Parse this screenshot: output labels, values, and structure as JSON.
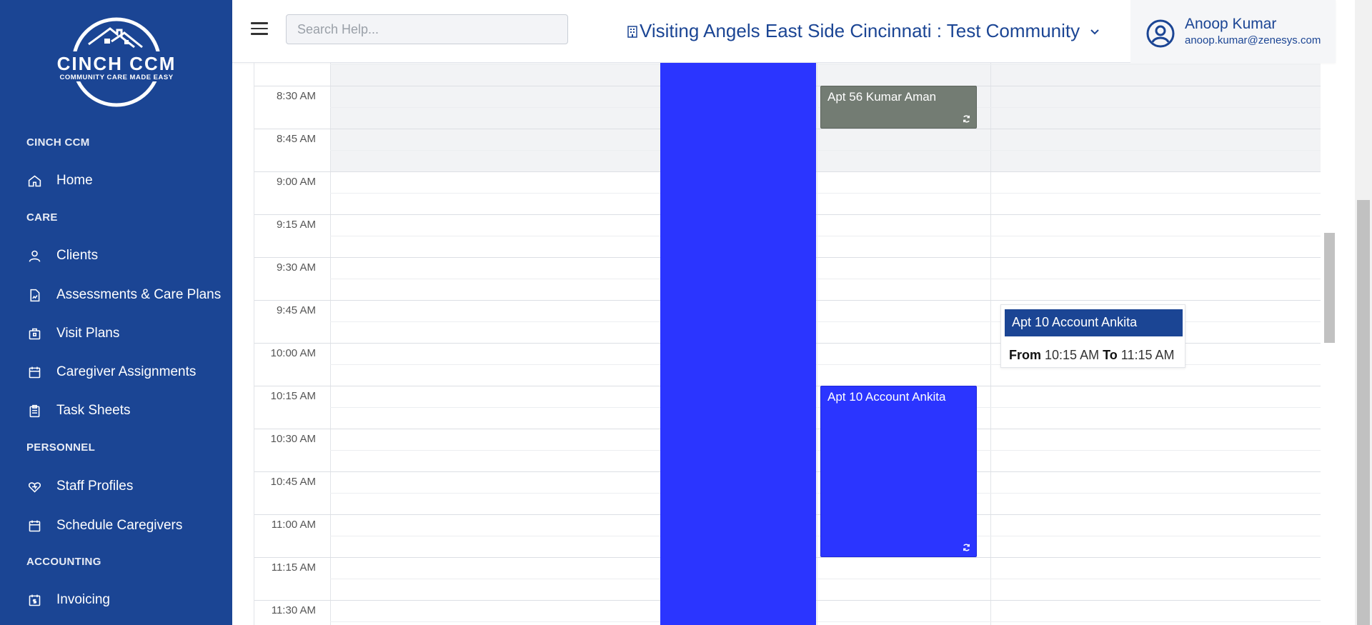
{
  "brand": {
    "logo_title": "CINCH CCM",
    "logo_tagline": "COMMUNITY CARE MADE EASY"
  },
  "sidebar": {
    "sections": [
      {
        "label": "CINCH CCM",
        "items": [
          {
            "label": "Home",
            "icon": "home-icon"
          }
        ]
      },
      {
        "label": "CARE",
        "items": [
          {
            "label": "Clients",
            "icon": "person-icon"
          },
          {
            "label": "Assessments & Care Plans",
            "icon": "document-chart-icon"
          },
          {
            "label": "Visit Plans",
            "icon": "briefcase-icon"
          },
          {
            "label": "Caregiver Assignments",
            "icon": "calendar-icon"
          },
          {
            "label": "Task Sheets",
            "icon": "clipboard-icon"
          }
        ]
      },
      {
        "label": "PERSONNEL",
        "items": [
          {
            "label": "Staff Profiles",
            "icon": "heart-badge-icon"
          },
          {
            "label": "Schedule Caregivers",
            "icon": "calendar-icon"
          }
        ]
      },
      {
        "label": "ACCOUNTING",
        "items": [
          {
            "label": "Invoicing",
            "icon": "invoice-icon"
          }
        ]
      }
    ]
  },
  "header": {
    "search_placeholder": "Search Help...",
    "community": "Visiting Angels East Side Cincinnati : Test Community",
    "user_name": "Anoop Kumar",
    "user_email": "anoop.kumar@zenesys.com"
  },
  "calendar": {
    "time_slots": [
      "8:30 AM",
      "8:45 AM",
      "9:00 AM",
      "9:15 AM",
      "9:30 AM",
      "9:45 AM",
      "10:00 AM",
      "10:15 AM",
      "10:30 AM",
      "10:45 AM",
      "11:00 AM",
      "11:15 AM",
      "11:30 AM"
    ],
    "events": [
      {
        "title": "Apt 56 Kumar Aman",
        "color": "#737c73",
        "recurring": true
      },
      {
        "title": "Apt 10 Account Ankita",
        "color": "#2b35ff",
        "recurring": true
      }
    ],
    "tooltip": {
      "title": "Apt 10 Account Ankita",
      "from_label": "From",
      "from_time": "10:15 AM",
      "to_label": "To",
      "to_time": "11:15 AM"
    }
  },
  "colors": {
    "sidebar_bg": "#1b4594",
    "accent_blue": "#2b35ff",
    "event_grey": "#737c73"
  }
}
